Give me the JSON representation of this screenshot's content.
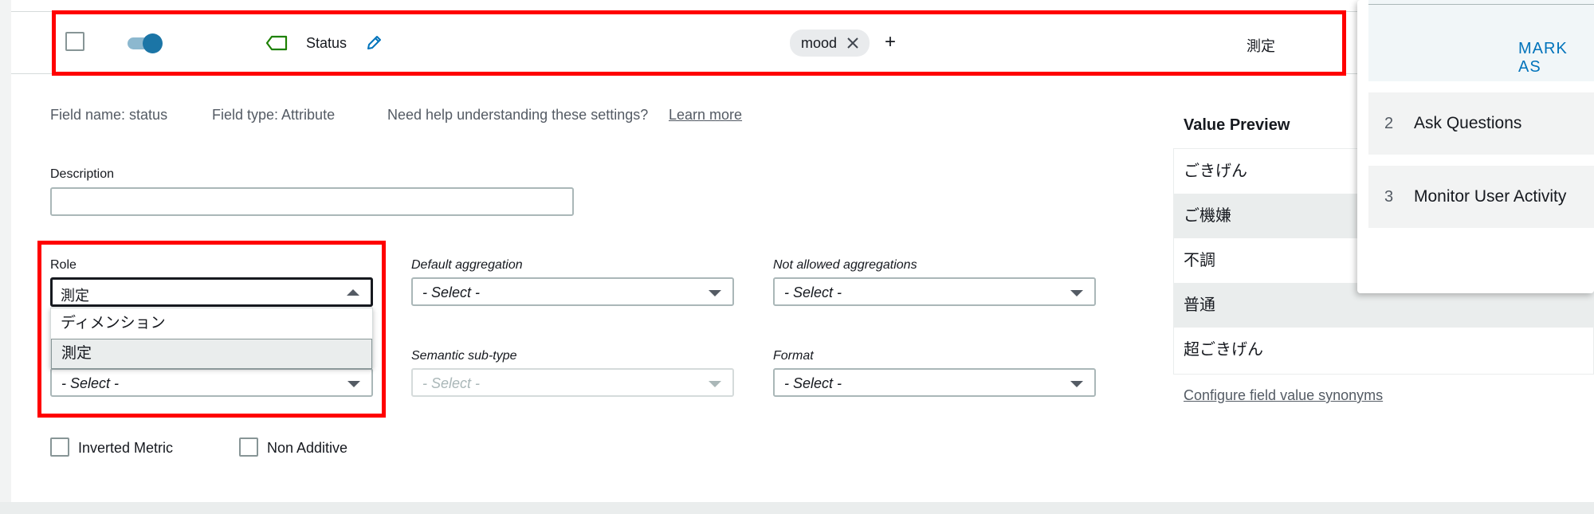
{
  "row": {
    "field_label": "Status",
    "tag_chip": "mood",
    "add_symbol": "+",
    "role_value": "測定"
  },
  "info": {
    "field_name": "Field name: status",
    "field_type": "Field type: Attribute",
    "help_text": "Need help understanding these settings?",
    "learn_more": "Learn more"
  },
  "form": {
    "description_label": "Description",
    "description_value": "",
    "role_label": "Role",
    "role_selected": "測定",
    "role_options": [
      "ディメンション",
      "測定"
    ],
    "semantic_type_value": "- Select -",
    "default_aggregation_label": "Default aggregation",
    "default_aggregation_value": "- Select -",
    "not_allowed_label": "Not allowed aggregations",
    "not_allowed_value": "- Select -",
    "semantic_subtype_label": "Semantic sub-type",
    "semantic_subtype_value": "- Select -",
    "format_label": "Format",
    "format_value": "- Select -",
    "inverted_metric": "Inverted Metric",
    "non_additive": "Non Additive"
  },
  "preview": {
    "title": "Value Preview",
    "values": [
      "ごきげん",
      "ご機嫌",
      "不調",
      "普通",
      "超ごきげん"
    ],
    "synonyms_link": "Configure field value synonyms"
  },
  "panel": {
    "mark_as": "MARK AS",
    "items": [
      {
        "num": "2",
        "label": "Ask Questions"
      },
      {
        "num": "3",
        "label": "Monitor User Activity"
      }
    ]
  },
  "colors": {
    "highlight": "#ff0000",
    "toggle": "#1b75a6",
    "link_blue": "#0073bb"
  }
}
